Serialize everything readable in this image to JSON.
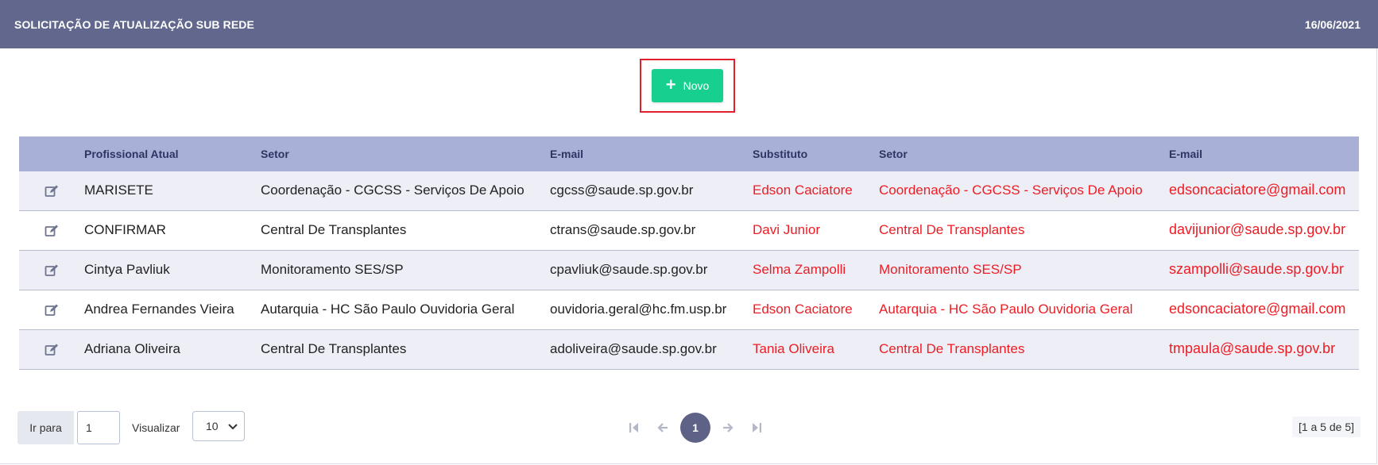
{
  "header": {
    "title": "SOLICITAÇÃO DE ATUALIZAÇÃO SUB REDE",
    "date": "16/06/2021"
  },
  "actions": {
    "new_label": "Novo"
  },
  "table": {
    "columns": [
      "Profissional Atual",
      "Setor",
      "E-mail",
      "Substituto",
      "Setor",
      "E-mail"
    ],
    "rows": [
      [
        "MARISETE",
        "Coordenação - CGCSS - Serviços De Apoio",
        "cgcss@saude.sp.gov.br",
        "Edson Caciatore",
        "Coordenação - CGCSS - Serviços De Apoio",
        "edsoncaciatore@gmail.com"
      ],
      [
        "CONFIRMAR",
        "Central De Transplantes",
        "ctrans@saude.sp.gov.br",
        "Davi Junior",
        "Central De Transplantes",
        "davijunior@saude.sp.gov.br"
      ],
      [
        "Cintya Pavliuk",
        "Monitoramento SES/SP",
        "cpavliuk@saude.sp.gov.br",
        "Selma Zampolli",
        "Monitoramento SES/SP",
        "szampolli@saude.sp.gov.br"
      ],
      [
        "Andrea Fernandes Vieira",
        "Autarquia - HC São Paulo Ouvidoria Geral",
        "ouvidoria.geral@hc.fm.usp.br",
        "Edson Caciatore",
        "Autarquia - HC São Paulo Ouvidoria Geral",
        "edsoncaciatore@gmail.com"
      ],
      [
        "Adriana Oliveira",
        "Central De Transplantes",
        "adoliveira@saude.sp.gov.br",
        "Tania Oliveira",
        "Central De Transplantes",
        "tmpaula@saude.sp.gov.br"
      ]
    ]
  },
  "footer": {
    "goto_label": "Ir para",
    "goto_value": "1",
    "view_label": "Visualizar",
    "page_size": "10",
    "current_page": "1",
    "count_text": "[1 a 5 de 5]"
  },
  "colors": {
    "header_bg": "#62688d",
    "table_head_bg": "#a9b0d8",
    "accent_green": "#17d08f",
    "substitute_red": "#ee1c24",
    "highlight_border": "#e0202a"
  },
  "icons": {
    "row_action": "edit-icon",
    "pager": [
      "first-page-icon",
      "prev-page-icon",
      "next-page-icon",
      "last-page-icon"
    ]
  }
}
